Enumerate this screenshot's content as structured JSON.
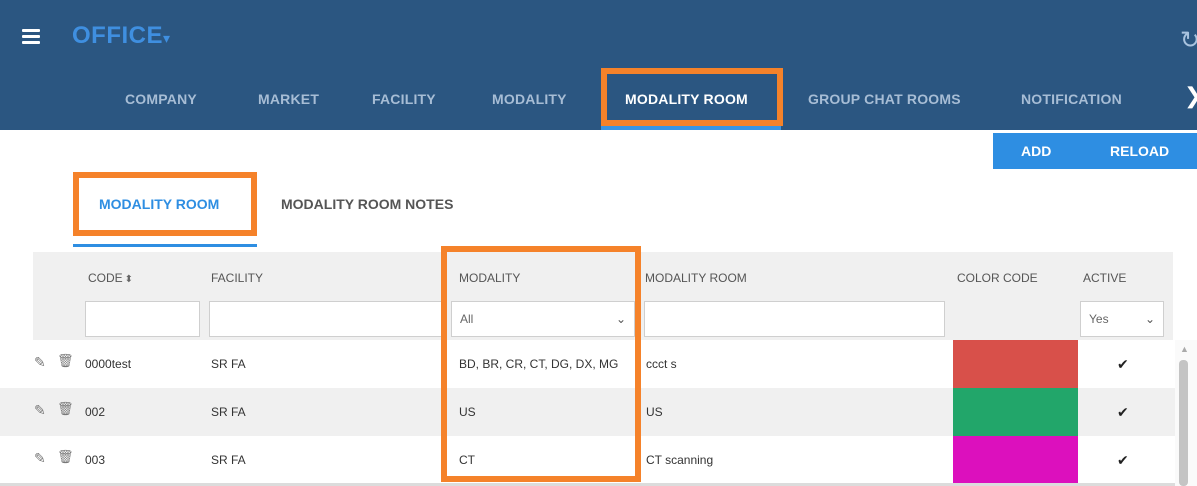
{
  "app": {
    "title": "OFFICE",
    "title_caret": "▾",
    "refresh_glyph": "↻",
    "chevron_glyph": "❯",
    "menu_icon": "hamburger-icon"
  },
  "nav": {
    "tabs": [
      {
        "label": "COMPANY"
      },
      {
        "label": "MARKET"
      },
      {
        "label": "FACILITY"
      },
      {
        "label": "MODALITY"
      },
      {
        "label": "MODALITY ROOM",
        "active": true
      },
      {
        "label": "GROUP CHAT ROOMS"
      },
      {
        "label": "NOTIFICATION"
      }
    ]
  },
  "actions": {
    "add_label": "ADD",
    "reload_label": "RELOAD"
  },
  "subtabs": [
    {
      "label": "MODALITY ROOM",
      "active": true
    },
    {
      "label": "MODALITY ROOM NOTES"
    }
  ],
  "grid": {
    "columns": {
      "code": "CODE",
      "code_sort_glyph": "⬍",
      "facility": "FACILITY",
      "modality": "MODALITY",
      "modality_room": "MODALITY ROOM",
      "color_code": "COLOR CODE",
      "active": "ACTIVE"
    },
    "filters": {
      "code": "",
      "facility": "",
      "modality_selected": "All",
      "modality_room": "",
      "active_selected": "Yes",
      "select_glyph": "⌄"
    },
    "rows": [
      {
        "code": "0000test",
        "facility": "SR FA",
        "modality": "BD, BR, CR, CT, DG, DX, MG",
        "modality_room": "ccct s",
        "color": "#d8504a",
        "active_glyph": "✔"
      },
      {
        "code": "002",
        "facility": "SR FA",
        "modality": "US",
        "modality_room": "US",
        "color": "#22a66a",
        "active_glyph": "✔"
      },
      {
        "code": "003",
        "facility": "SR FA",
        "modality": "CT",
        "modality_room": "CT scanning",
        "color": "#dc10bd",
        "active_glyph": "✔"
      }
    ],
    "row_icons": {
      "edit_glyph": "✎",
      "delete_glyph": "🗑"
    },
    "scroll_up_glyph": "▲"
  },
  "colors": {
    "header_bg": "#2b5681",
    "accent": "#2e8ee2",
    "highlight": "#f5822a"
  }
}
